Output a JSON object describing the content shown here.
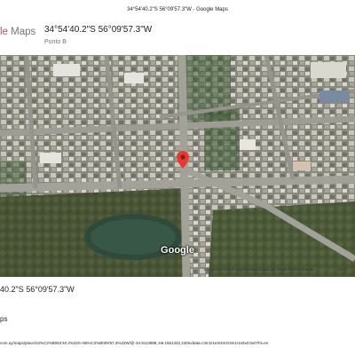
{
  "page_header": "34°54'40.2\"S 56°09'57.3\"W - Google Maps",
  "brand": {
    "part1": "le",
    "part2": " Maps"
  },
  "place": {
    "title": "34°54'40.2\"S 56°09'57.3\"W",
    "subtitle": "Punto B"
  },
  "map": {
    "watermark": "Google",
    "pin_icon": "map-pin-icon",
    "pin_color": "#e53935",
    "attribution": "Imágenes ©2016 DigitalGlobe,Datos del mapa ©2016 Google",
    "scale": "20 m"
  },
  "footer": {
    "coords": "40.2\"S 56°09'57.3\"W",
    "brand": "ps",
    "url": "com.uy/maps/place/34%C2%B054'40.2%22S+56%C2%B009'57.3%22W/@-34.9113888,-56.1661322,240m/data=!3m1!1e3!4m2!3m1!1s0x0:0x0?hl=es"
  }
}
